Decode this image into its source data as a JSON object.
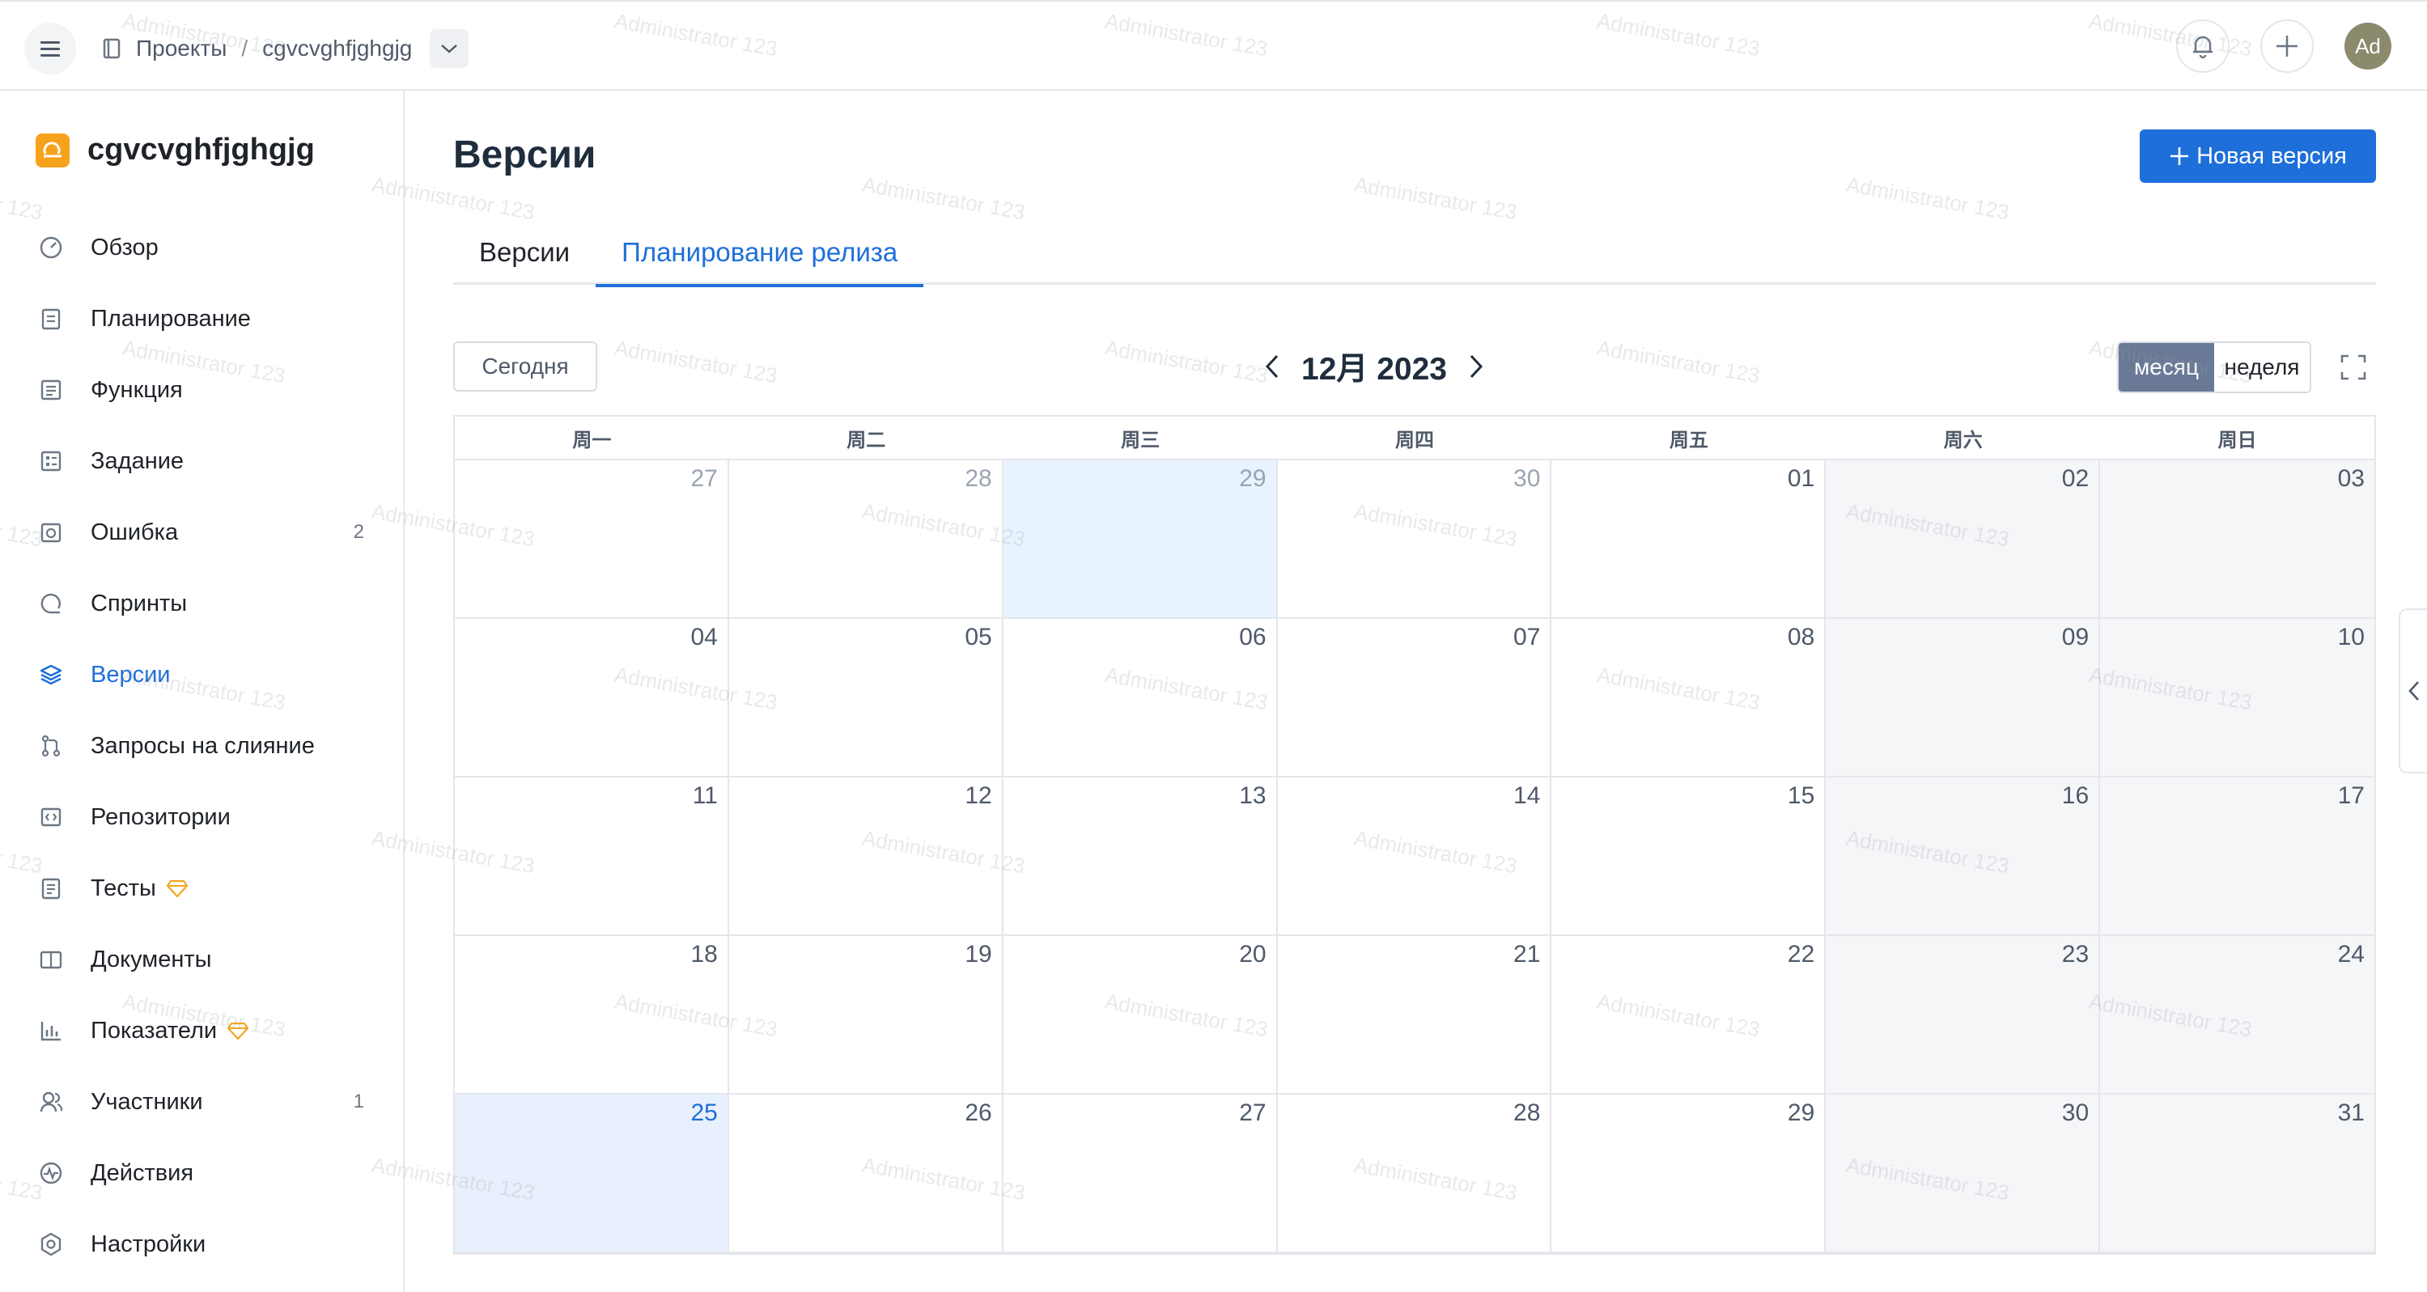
{
  "header": {
    "breadcrumb_projects": "Проекты",
    "breadcrumb_separator": "/",
    "breadcrumb_project": "cgvcvghfjghgjg",
    "avatar_initials": "Ad",
    "icons": [
      "menu-icon",
      "book-icon",
      "chevron-down-icon",
      "bell-icon",
      "plus-icon"
    ]
  },
  "sidebar": {
    "project_name": "cgvcvghfjghgjg",
    "items": [
      {
        "label": "Обзор",
        "icon": "gauge-icon",
        "badge": ""
      },
      {
        "label": "Планирование",
        "icon": "clipboard-icon",
        "badge": ""
      },
      {
        "label": "Функция",
        "icon": "document-list-icon",
        "badge": ""
      },
      {
        "label": "Задание",
        "icon": "checklist-icon",
        "badge": ""
      },
      {
        "label": "Ошибка",
        "icon": "bug-icon",
        "badge": "2"
      },
      {
        "label": "Спринты",
        "icon": "sprint-icon",
        "badge": ""
      },
      {
        "label": "Версии",
        "icon": "layers-icon",
        "badge": "",
        "active": true
      },
      {
        "label": "Запросы на слияние",
        "icon": "merge-icon",
        "badge": ""
      },
      {
        "label": "Репозитории",
        "icon": "code-icon",
        "badge": ""
      },
      {
        "label": "Тесты",
        "icon": "test-list-icon",
        "badge": "",
        "premium": true
      },
      {
        "label": "Документы",
        "icon": "book-open-icon",
        "badge": ""
      },
      {
        "label": "Показатели",
        "icon": "bar-chart-icon",
        "badge": "",
        "premium": true
      },
      {
        "label": "Участники",
        "icon": "users-icon",
        "badge": "1"
      },
      {
        "label": "Действия",
        "icon": "activity-icon",
        "badge": ""
      },
      {
        "label": "Настройки",
        "icon": "gear-icon",
        "badge": ""
      }
    ]
  },
  "main": {
    "title": "Версии",
    "new_version_label": "Новая версия",
    "tabs": [
      {
        "label": "Версии",
        "active": false
      },
      {
        "label": "Планирование релиза",
        "active": true
      }
    ],
    "today_label": "Сегодня",
    "month_label": "12月 2023",
    "view_month": "месяц",
    "view_week": "неделя"
  },
  "calendar": {
    "weekdays": [
      "周一",
      "周二",
      "周三",
      "周四",
      "周五",
      "周六",
      "周日"
    ],
    "weeks": [
      [
        "27",
        "28",
        "29",
        "30",
        "01",
        "02",
        "03"
      ],
      [
        "04",
        "05",
        "06",
        "07",
        "08",
        "09",
        "10"
      ],
      [
        "11",
        "12",
        "13",
        "14",
        "15",
        "16",
        "17"
      ],
      [
        "18",
        "19",
        "20",
        "21",
        "22",
        "23",
        "24"
      ],
      [
        "25",
        "26",
        "27",
        "28",
        "29",
        "30",
        "31"
      ]
    ],
    "previous_month_days_in_first_week": 4,
    "selected_day": "29",
    "today_day": "25"
  },
  "watermark_text": "Administrator 123",
  "colors": {
    "accent": "#1e6fd9",
    "project_logo": "#f7a21b",
    "view_active": "#6a7a96",
    "weekend_bg": "#f5f6f8",
    "selected_bg": "#e8f3ff"
  }
}
